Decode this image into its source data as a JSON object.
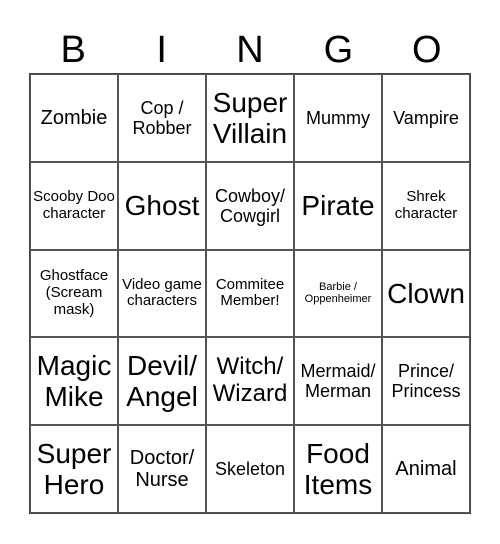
{
  "header": [
    "B",
    "I",
    "N",
    "G",
    "O"
  ],
  "cells": [
    "Zombie",
    "Cop / Robber",
    "Super Villain",
    "Mummy",
    "Vampire",
    "Scooby Doo character",
    "Ghost",
    "Cowboy/ Cowgirl",
    "Pirate",
    "Shrek character",
    "Ghostface (Scream mask)",
    "Video game characters",
    "Commitee Member!",
    "Barbie / Oppenheimer",
    "Clown",
    "Magic Mike",
    "Devil/ Angel",
    "Witch/ Wizard",
    "Mermaid/ Merman",
    "Prince/ Princess",
    "Super Hero",
    "Doctor/ Nurse",
    "Skeleton",
    "Food Items",
    "Animal"
  ]
}
